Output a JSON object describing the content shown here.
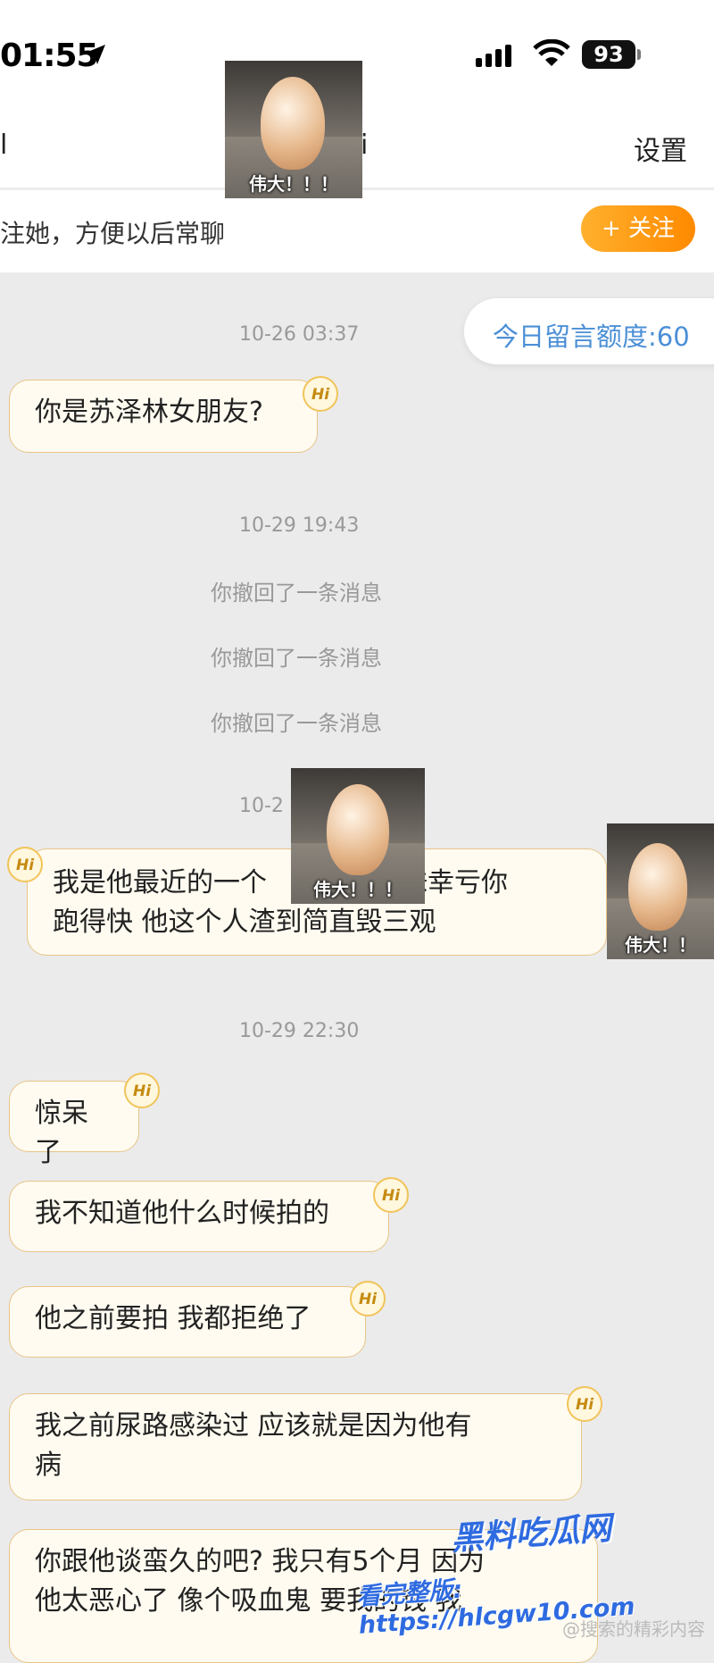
{
  "status_bar": {
    "time": "01:55",
    "battery": "93"
  },
  "header": {
    "back_fragment": "l",
    "title_fragment": "i",
    "settings_label": "设置"
  },
  "follow_bar": {
    "text": "注她，方便以后常聊",
    "button_label": "+ 关注"
  },
  "quota": {
    "label": "今日留言额度:60"
  },
  "timestamps": [
    "10-26 03:37",
    "10-29 19:43",
    "10-2",
    "10-29 22:30"
  ],
  "system_messages": [
    "你撤回了一条消息",
    "你撤回了一条消息",
    "你撤回了一条消息"
  ],
  "messages": [
    {
      "text": "你是苏泽林女朋友?",
      "badge": "Hi"
    },
    {
      "line1": "我是他最近的一个",
      "line1_tail": "妹幸亏你",
      "line2": "跑得快  他这个人渣到简直毁三观",
      "badge": "Hi"
    },
    {
      "text": "惊呆了",
      "badge": "Hi"
    },
    {
      "text": "我不知道他什么时候拍的",
      "badge": "Hi"
    },
    {
      "text": "他之前要拍 我都拒绝了",
      "badge": "Hi"
    },
    {
      "line1": "我之前尿路感染过 应该就是因为他有",
      "line2": "病",
      "badge": "Hi"
    },
    {
      "line1": "你跟他谈蛮久的吧? 我只有5个月 因为",
      "line2": "他太恶心了 像个吸血鬼 要我的钱 我"
    }
  ],
  "stickers": [
    {
      "caption": "伟大！！！"
    },
    {
      "caption": "伟大！！！"
    },
    {
      "caption": "伟大！！"
    }
  ],
  "watermark": {
    "line1": "黑料吃瓜网",
    "line2": "看完整版: https://hlcgw10.com",
    "weibo": "@搜索的精彩内容"
  }
}
